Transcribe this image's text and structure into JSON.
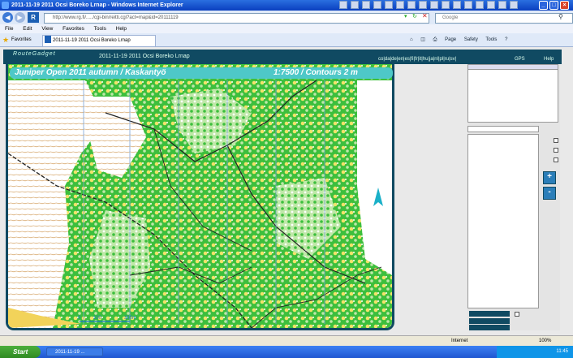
{
  "window": {
    "title": "2011-11-19 2011 Ocsi Boreko Lrnap - Windows Internet Explorer"
  },
  "addressbar": {
    "url": "http://www.rg.fi/...../cgi-bin/reitti.cgi?act=map&id=20111119",
    "search_placeholder": "Google"
  },
  "menubar": {
    "items": [
      "File",
      "Edit",
      "View",
      "Favorites",
      "Tools",
      "Help"
    ]
  },
  "tabs": {
    "favorites_label": "Favorites",
    "active_tab": "2011-11-19 2011 Ocsi Boreko Lrnap",
    "tools": [
      "Page",
      "Safety",
      "Tools"
    ]
  },
  "routegadget": {
    "logo": "RouteGadget",
    "map_name": "2011-11-19 2011 Ocsi Boreko Lrnap",
    "menu_links": "co|da|de|en|es|fi|fr|it|hu|ja|nl|pl|ru|sv|",
    "gps_link": "GPS",
    "help_link": "Help"
  },
  "map": {
    "title": "Juniper Open 2011 autumn / Kaskantyö",
    "scale_contours": "1:7500 / Contours 2 m",
    "scale_bar_labels": [
      "0",
      "100",
      "300m"
    ]
  },
  "panel": {
    "class_list_header": "",
    "class_select": "",
    "zoom_in": "+",
    "zoom_out": "-",
    "buttons": [
      "",
      "",
      ""
    ]
  },
  "statusbar": {
    "zone": "Internet",
    "zoom": "100%"
  },
  "taskbar": {
    "start": "Start",
    "task": "2011-11-19 ...",
    "clock": "11:45"
  },
  "colors": {
    "header": "#104a62",
    "map_title_bg": "#4ec8c8",
    "forest": "#3dbf3d",
    "light_forest": "#bfe8a8",
    "open": "#f2d35a"
  }
}
